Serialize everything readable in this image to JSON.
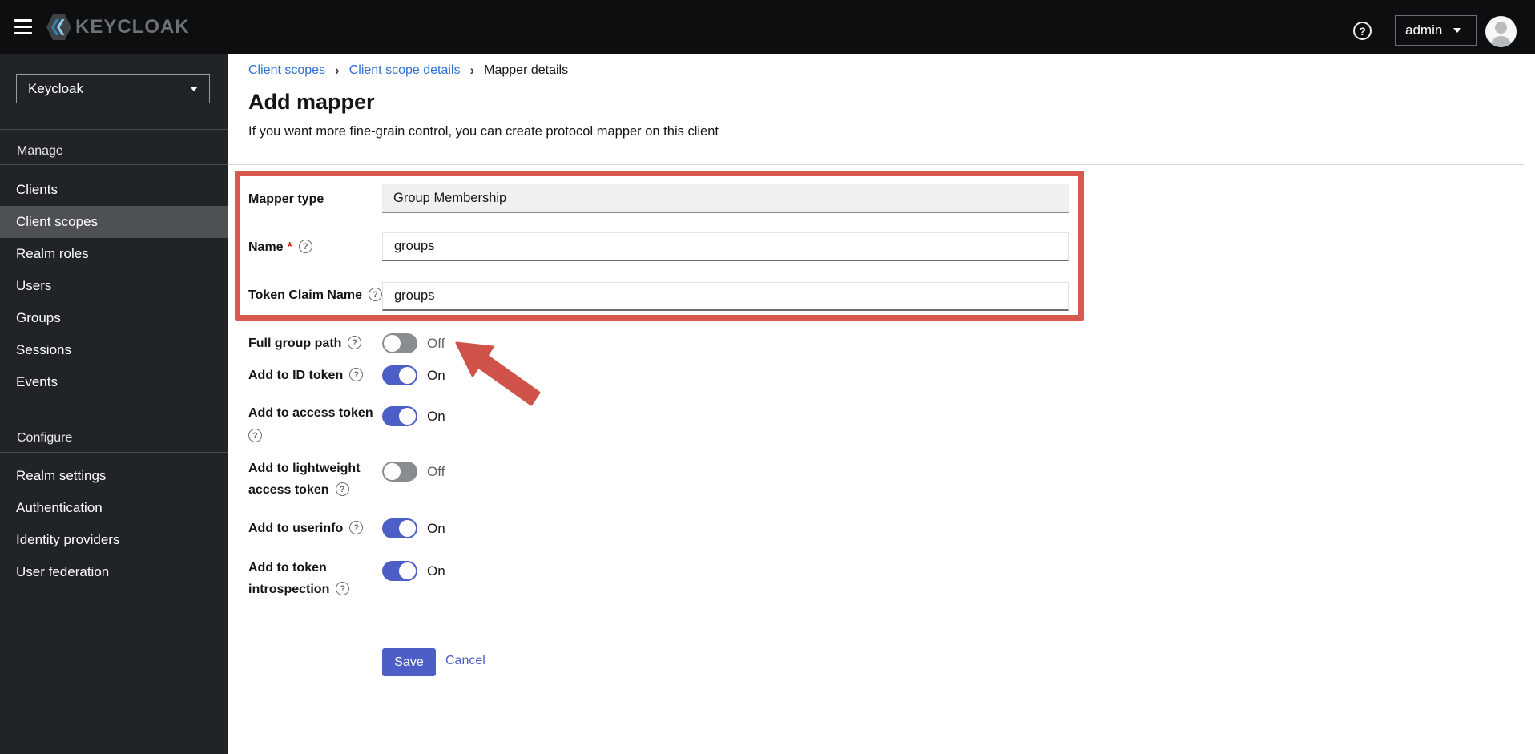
{
  "header": {
    "product_name": "KEYCLOAK",
    "admin_menu_label": "admin"
  },
  "realm_selector": {
    "value": "Keycloak"
  },
  "sidebar": {
    "manage_label": "Manage",
    "manage_items": [
      "Clients",
      "Client scopes",
      "Realm roles",
      "Users",
      "Groups",
      "Sessions",
      "Events"
    ],
    "active_item": "Client scopes",
    "configure_label": "Configure",
    "configure_items": [
      "Realm settings",
      "Authentication",
      "Identity providers",
      "User federation"
    ]
  },
  "breadcrumb": {
    "items": [
      "Client scopes",
      "Client scope details",
      "Mapper details"
    ]
  },
  "page": {
    "title": "Add mapper",
    "subtitle": "If you want more fine-grain control, you can create protocol mapper on this client"
  },
  "form": {
    "mapper_type": {
      "label": "Mapper type",
      "value": "Group Membership"
    },
    "name": {
      "label": "Name",
      "required_marker": "*",
      "value": "groups"
    },
    "token_claim_name": {
      "label": "Token Claim Name",
      "value": "groups"
    },
    "full_group_path": {
      "label": "Full group path",
      "state_label": "Off",
      "on": false
    },
    "add_to_id_token": {
      "label": "Add to ID token",
      "state_label": "On",
      "on": true
    },
    "add_to_access_token": {
      "label": "Add to access token",
      "state_label": "On",
      "on": true
    },
    "add_to_lightweight_access_token": {
      "label_line1": "Add to lightweight",
      "label_line2": "access token",
      "state_label": "Off",
      "on": false
    },
    "add_to_userinfo": {
      "label": "Add to userinfo",
      "state_label": "On",
      "on": true
    },
    "add_to_token_introspection": {
      "label_line1": "Add to token",
      "label_line2": "introspection",
      "state_label": "On",
      "on": true
    },
    "actions": {
      "save": "Save",
      "cancel": "Cancel"
    }
  },
  "icons": {
    "help_glyph": "?",
    "breadcrumb_divider_glyph": "›"
  },
  "colors": {
    "annotation_red": "#d9584e",
    "toggle_on_blue": "#4d5ec6",
    "link_blue": "#2f6fd4",
    "header_bg": "#0c0e0f",
    "sidebar_bg": "#212427",
    "sidebar_active_bg": "#4d5154",
    "required_red": "#c9190b"
  }
}
